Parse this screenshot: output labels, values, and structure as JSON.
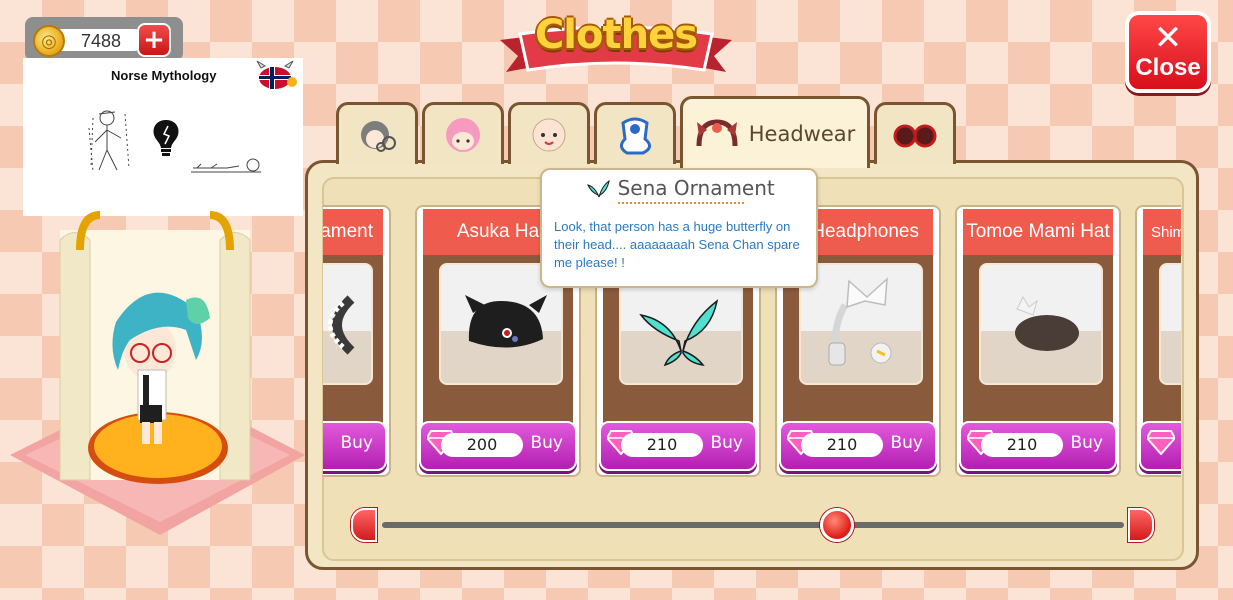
{
  "currency": {
    "coins": "7488",
    "add_label": "+"
  },
  "overlay": {
    "title": "Norse Mythology"
  },
  "header": {
    "title": "Clothes",
    "close_label": "Close",
    "close_symbol": "✕"
  },
  "tabs": [
    {
      "icon": "hair-icon",
      "label": ""
    },
    {
      "icon": "wig-icon",
      "label": ""
    },
    {
      "icon": "face-icon",
      "label": ""
    },
    {
      "icon": "outfit-icon",
      "label": ""
    },
    {
      "icon": "headwear-icon",
      "label": "Headwear",
      "active": true
    },
    {
      "icon": "glasses-icon",
      "label": ""
    }
  ],
  "items": [
    {
      "name": "rnament",
      "price": "",
      "buy": "Buy"
    },
    {
      "name": "Asuka Ha",
      "price": "200",
      "buy": "Buy"
    },
    {
      "name": "",
      "price": "210",
      "buy": "Buy"
    },
    {
      "name": "Headphones",
      "price": "210",
      "buy": "Buy"
    },
    {
      "name": "Tomoe Mami Hat",
      "price": "210",
      "buy": "Buy"
    },
    {
      "name": "Shim",
      "price": "",
      "buy": ""
    }
  ],
  "tooltip": {
    "title": "Sena Ornament",
    "text": "Look, that person has a huge butterfly on their head.... aaaaaaaah Sena Chan spare me please!  !"
  },
  "slider": {
    "position": 0.6
  },
  "colors": {
    "accent": "#ef5c4d",
    "buy": "#c433c1",
    "panel": "#f2e6c4"
  }
}
